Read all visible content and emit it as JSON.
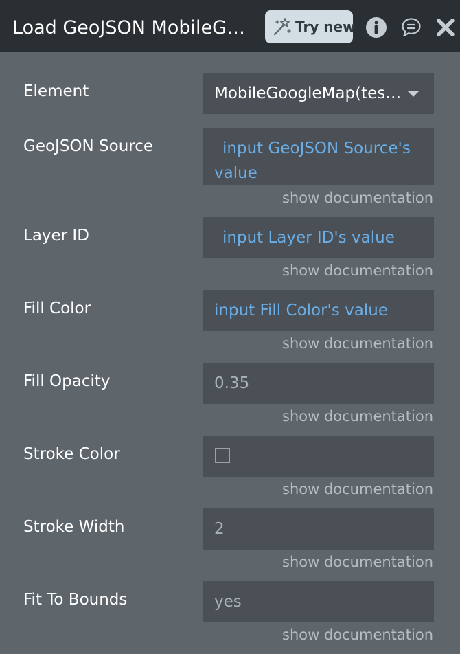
{
  "header": {
    "title": "Load GeoJSON MobileGoogleMap",
    "try_new_label": "Try new"
  },
  "fields": {
    "element": {
      "label": "Element",
      "value": "MobileGoogleMap(testing)"
    },
    "geojson_source": {
      "label": "GeoJSON Source",
      "line1": "input GeoJSON Source's",
      "line2": "value",
      "doc": "show documentation"
    },
    "layer_id": {
      "label": "Layer ID",
      "value": "input Layer ID's value",
      "doc": "show documentation"
    },
    "fill_color": {
      "label": "Fill Color",
      "value": "input Fill Color's value",
      "doc": "show documentation"
    },
    "fill_opacity": {
      "label": "Fill Opacity",
      "value": "0.35",
      "doc": "show documentation"
    },
    "stroke_color": {
      "label": "Stroke Color",
      "checked": false,
      "doc": "show documentation"
    },
    "stroke_width": {
      "label": "Stroke Width",
      "value": "2",
      "doc": "show documentation"
    },
    "fit_to_bounds": {
      "label": "Fit To Bounds",
      "value": "yes",
      "doc": "show documentation"
    }
  },
  "colors": {
    "panel_bg": "#5f666b",
    "header_bg": "#2a2f33",
    "input_bg": "#4a5056",
    "dynamic_text": "#6aaee8",
    "try_new_bg": "#d3dde4"
  },
  "icons": {
    "try_new": "magic-wand-icon",
    "info": "info-icon",
    "comment": "comment-icon",
    "close": "close-icon"
  }
}
